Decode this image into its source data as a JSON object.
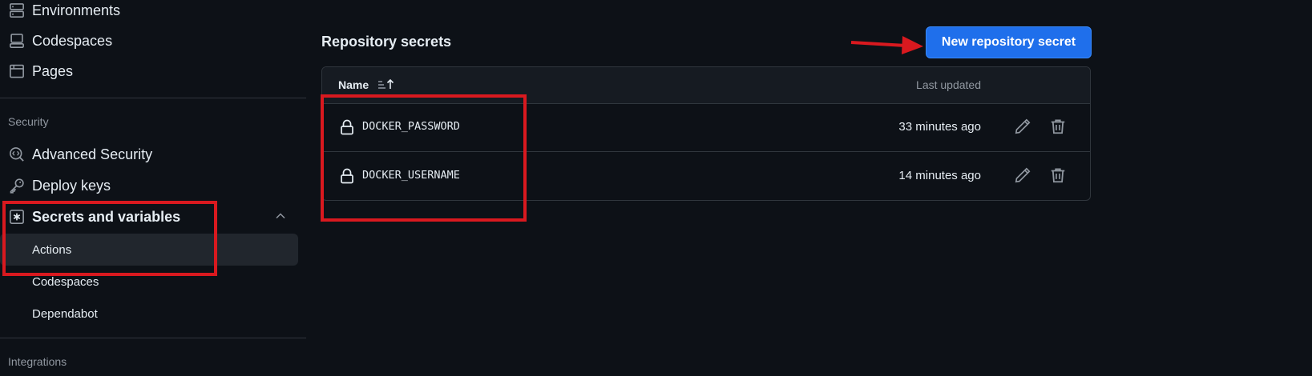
{
  "sidebar": {
    "items_top": [
      {
        "label": "Environments",
        "icon": "server-icon"
      },
      {
        "label": "Codespaces",
        "icon": "codespaces-icon"
      },
      {
        "label": "Pages",
        "icon": "browser-icon"
      }
    ],
    "security_section": {
      "title": "Security",
      "items": [
        {
          "label": "Advanced Security",
          "icon": "codescan-icon"
        },
        {
          "label": "Deploy keys",
          "icon": "key-icon"
        },
        {
          "label": "Secrets and variables",
          "icon": "asterisk-icon"
        }
      ],
      "sub_items": [
        {
          "label": "Actions",
          "active": true
        },
        {
          "label": "Codespaces",
          "active": false
        },
        {
          "label": "Dependabot",
          "active": false
        }
      ]
    },
    "integrations_section": {
      "title": "Integrations"
    }
  },
  "main": {
    "title": "Repository secrets",
    "new_button_label": "New repository secret",
    "table": {
      "col_name": "Name",
      "col_updated": "Last updated",
      "rows": [
        {
          "name": "DOCKER_PASSWORD",
          "updated": "33 minutes ago"
        },
        {
          "name": "DOCKER_USERNAME",
          "updated": "14 minutes ago"
        }
      ]
    }
  },
  "colors": {
    "background": "#0d1117",
    "accent": "#1f6feb",
    "annotation": "#d9191f"
  }
}
